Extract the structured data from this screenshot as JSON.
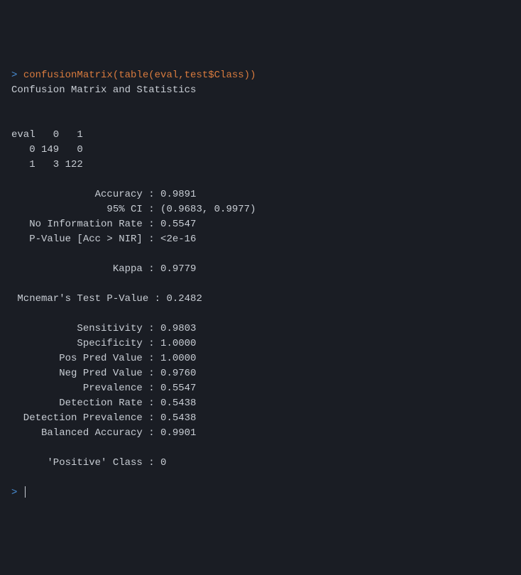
{
  "console": {
    "prompt_symbol": "> ",
    "command": "confusionMatrix(table(eval,test$Class))",
    "title": "Confusion Matrix and Statistics",
    "matrix_header": "eval   0   1",
    "matrix_row0": "   0 149   0",
    "matrix_row1": "   1   3 122",
    "stats": {
      "accuracy_label": "              Accuracy : ",
      "accuracy_value": "0.9891",
      "ci_label": "                95% CI : ",
      "ci_value": "(0.9683, 0.9977)",
      "nir_label": "   No Information Rate : ",
      "nir_value": "0.5547",
      "pvalue_label": "   P-Value [Acc > NIR] : ",
      "pvalue_value": "<2e-16",
      "kappa_label": "                 Kappa : ",
      "kappa_value": "0.9779",
      "mcnemar_label": " Mcnemar's Test P-Value : ",
      "mcnemar_value": "0.2482",
      "sensitivity_label": "           Sensitivity : ",
      "sensitivity_value": "0.9803",
      "specificity_label": "           Specificity : ",
      "specificity_value": "1.0000",
      "ppv_label": "        Pos Pred Value : ",
      "ppv_value": "1.0000",
      "npv_label": "        Neg Pred Value : ",
      "npv_value": "0.9760",
      "prevalence_label": "            Prevalence : ",
      "prevalence_value": "0.5547",
      "detection_rate_label": "        Detection Rate : ",
      "detection_rate_value": "0.5438",
      "detection_prev_label": "  Detection Prevalence : ",
      "detection_prev_value": "0.5438",
      "balanced_acc_label": "     Balanced Accuracy : ",
      "balanced_acc_value": "0.9901",
      "positive_class_label": "      'Positive' Class : ",
      "positive_class_value": "0"
    }
  }
}
